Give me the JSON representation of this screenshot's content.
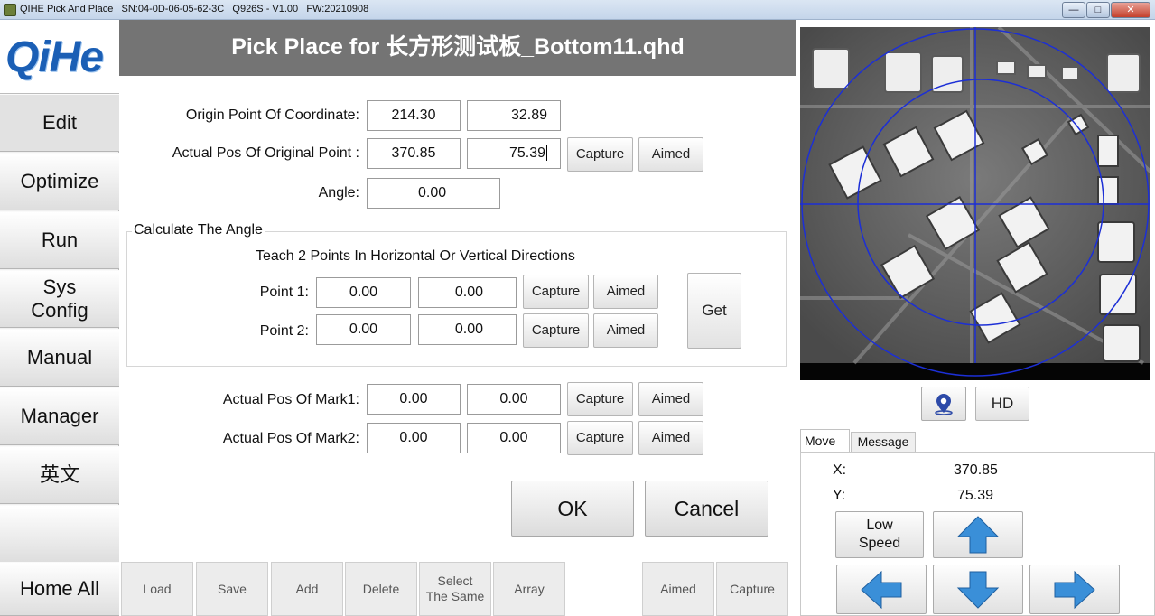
{
  "window": {
    "app_name": "QIHE Pick And Place",
    "serial": "SN:04-0D-06-05-62-3C",
    "model": "Q926S - V1.00",
    "firmware": "FW:20210908"
  },
  "logo": "QiHe",
  "sidebar": {
    "items": [
      {
        "label": "Edit"
      },
      {
        "label": "Optimize"
      },
      {
        "label": "Run"
      },
      {
        "label": "Sys\nConfig"
      },
      {
        "label": "Manual"
      },
      {
        "label": "Manager"
      },
      {
        "label": "英文"
      },
      {
        "label": ""
      },
      {
        "label": "Home All"
      }
    ]
  },
  "header": {
    "title": "Pick Place for 长方形测试板_Bottom11.qhd"
  },
  "form": {
    "origin": {
      "label": "Origin Point Of Coordinate:",
      "x": "214.30",
      "y": "32.89"
    },
    "actual_origin": {
      "label": "Actual Pos Of Original Point :",
      "x": "370.85",
      "y": "75.39",
      "capture": "Capture",
      "aimed": "Aimed"
    },
    "angle": {
      "label": "Angle:",
      "value": "0.00"
    },
    "calc_group": {
      "caption": "Calculate The Angle",
      "instruction": "Teach 2 Points In Horizontal Or Vertical Directions",
      "point1": {
        "label": "Point 1:",
        "x": "0.00",
        "y": "0.00",
        "capture": "Capture",
        "aimed": "Aimed"
      },
      "point2": {
        "label": "Point 2:",
        "x": "0.00",
        "y": "0.00",
        "capture": "Capture",
        "aimed": "Aimed"
      },
      "get": "Get"
    },
    "mark1": {
      "label": "Actual Pos Of Mark1:",
      "x": "0.00",
      "y": "0.00",
      "capture": "Capture",
      "aimed": "Aimed"
    },
    "mark2": {
      "label": "Actual Pos Of Mark2:",
      "x": "0.00",
      "y": "0.00",
      "capture": "Capture",
      "aimed": "Aimed"
    },
    "ok": "OK",
    "cancel": "Cancel"
  },
  "toolbar": {
    "load": "Load",
    "save": "Save",
    "add": "Add",
    "delete": "Delete",
    "select_same_1": "Select",
    "select_same_2": "The Same",
    "array": "Array",
    "aimed": "Aimed",
    "capture": "Capture"
  },
  "camera": {
    "hd_label": "HD",
    "location_icon": "location-pin-icon"
  },
  "tabs": {
    "move": "Move",
    "message": "Message"
  },
  "move_panel": {
    "x_label": "X:",
    "x_value": "370.85",
    "y_label": "Y:",
    "y_value": "75.39",
    "speed_1": "Low",
    "speed_2": "Speed",
    "arrow_icons": [
      "arrow-up-icon",
      "arrow-left-icon",
      "arrow-down-icon",
      "arrow-right-icon"
    ]
  },
  "colors": {
    "header_bg": "#747474",
    "logo": "#1b5fb5",
    "crosshair": "#1c2fd6",
    "arrow": "#3a8fd8"
  }
}
